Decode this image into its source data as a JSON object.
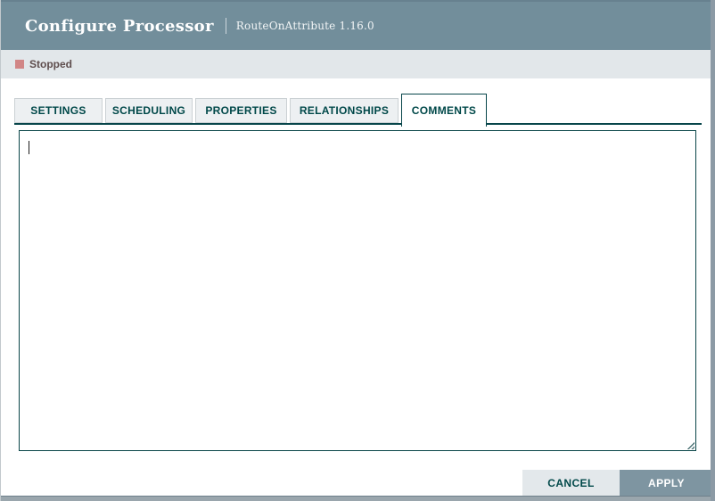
{
  "header": {
    "title": "Configure Processor",
    "subtitle": "RouteOnAttribute 1.16.0"
  },
  "status": {
    "label": "Stopped",
    "state_color": "#d18686"
  },
  "tabs": {
    "active": "COMMENTS",
    "items": [
      {
        "label": "SETTINGS"
      },
      {
        "label": "SCHEDULING"
      },
      {
        "label": "PROPERTIES"
      },
      {
        "label": "RELATIONSHIPS"
      },
      {
        "label": "COMMENTS"
      }
    ]
  },
  "comments": {
    "value": "",
    "placeholder": ""
  },
  "footer": {
    "cancel_label": "CANCEL",
    "apply_label": "APPLY"
  },
  "colors": {
    "header_bg": "#728e9b",
    "statusbar_bg": "#e2e7ea",
    "accent_teal": "#004849",
    "stopped_red": "#d18686",
    "apply_bg": "#7e95a1",
    "cancel_bg": "#e3e8eb"
  }
}
